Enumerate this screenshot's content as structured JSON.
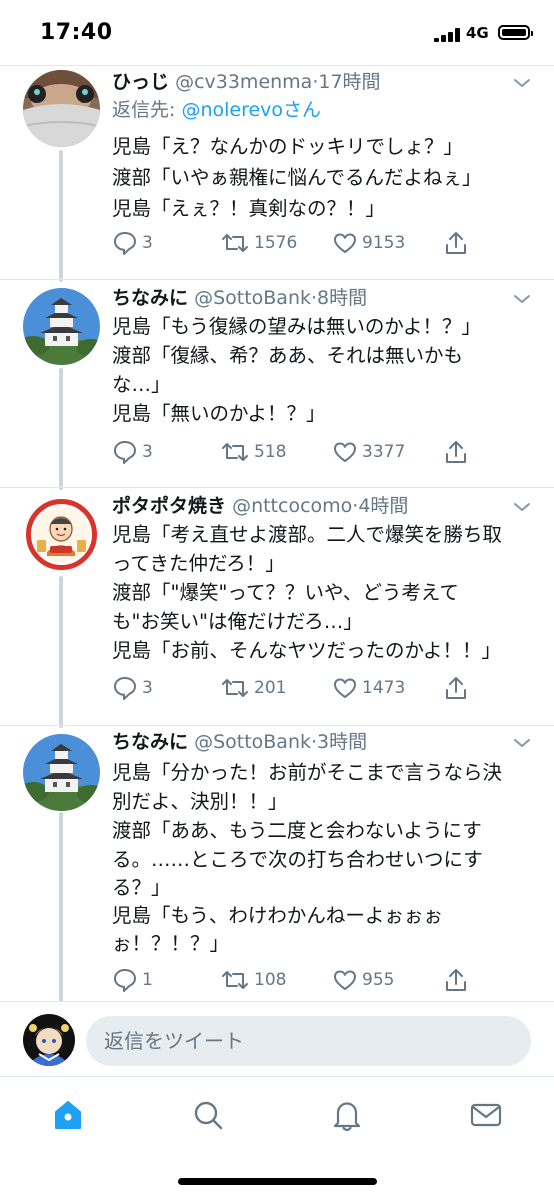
{
  "status_bar": {
    "time": "17:40",
    "network": "4G"
  },
  "colors": {
    "accent": "#1da1f2",
    "secondary_text": "#657786",
    "thread_line": "#ccd6dd",
    "divider": "#e1e8ed"
  },
  "tweets": [
    {
      "name": "ひっじ",
      "handle": "@cv33menma",
      "dot": "·",
      "time": "17時間",
      "reply_prefix": "返信先: ",
      "reply_handle": "@nolerevoさん",
      "lines": [
        "児島「え？なんかのドッキリでしょ？」",
        "渡部「いやぁ親権に悩んでるんだよねぇ」",
        "児島「えぇ？！真剣なの？！」"
      ],
      "replies": "3",
      "retweets": "1576",
      "likes": "9153"
    },
    {
      "name": "ちなみに",
      "handle": "@SottoBank",
      "dot": "·",
      "time": "8時間",
      "lines": [
        "児島「もう復縁の望みは無いのかよ！？」",
        "渡部「復縁、希？ああ、それは無いかも",
        "な…」",
        "児島「無いのかよ！？」"
      ],
      "replies": "3",
      "retweets": "518",
      "likes": "3377"
    },
    {
      "name": "ポタポタ焼き",
      "handle": "@nttcocomo",
      "dot": "·",
      "time": "4時間",
      "lines": [
        "児島「考え直せよ渡部。二人で爆笑を勝ち取",
        "ってきた仲だろ！」",
        "渡部「\"爆笑\"って？？いや、どう考えて",
        "も\"お笑い\"は俺だけだろ…」",
        "児島「お前、そんなヤツだったのかよ！！」"
      ],
      "replies": "3",
      "retweets": "201",
      "likes": "1473"
    },
    {
      "name": "ちなみに",
      "handle": "@SottoBank",
      "dot": "·",
      "time": "3時間",
      "lines": [
        "児島「分かった！お前がそこまで言うなら決",
        "別だよ、決別！！」",
        "渡部「ああ、もう二度と会わないようにす",
        "る。……ところで次の打ち合わせいつにす",
        "る？」",
        "児島「もう、わけわかんねーよぉぉぉ",
        "ぉ！？！？」"
      ],
      "replies": "1",
      "retweets": "108",
      "likes": "955"
    }
  ],
  "composer": {
    "placeholder": "返信をツイート"
  },
  "tabbar": {
    "items": [
      "home-icon",
      "search-icon",
      "notifications-icon",
      "messages-icon"
    ]
  }
}
